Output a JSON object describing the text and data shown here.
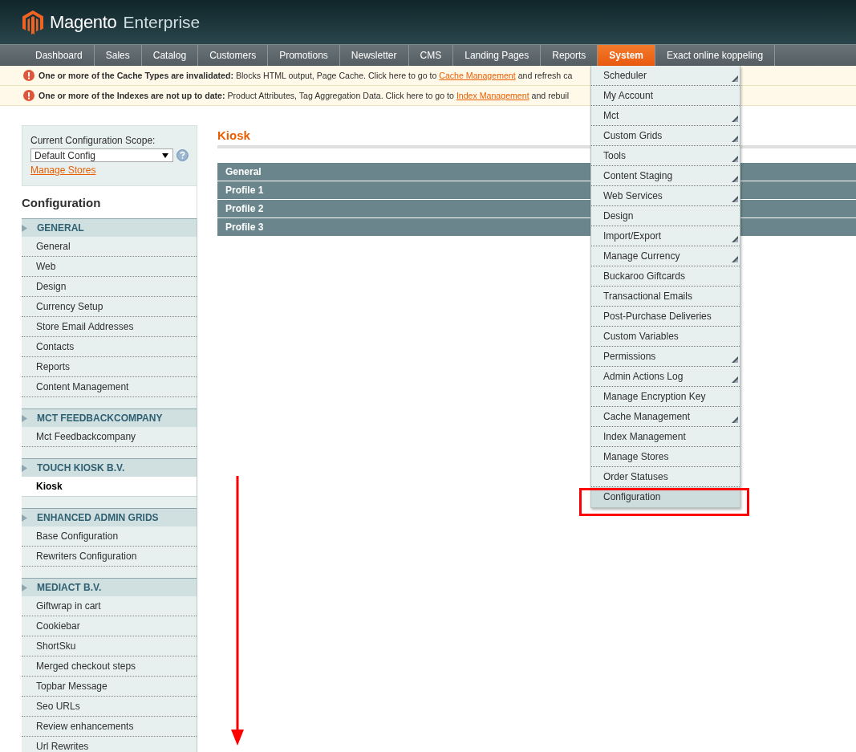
{
  "header": {
    "logo_brand": "Magento",
    "logo_edition": "Enterprise"
  },
  "nav": [
    {
      "label": "Dashboard",
      "selected": false
    },
    {
      "label": "Sales",
      "selected": false
    },
    {
      "label": "Catalog",
      "selected": false
    },
    {
      "label": "Customers",
      "selected": false
    },
    {
      "label": "Promotions",
      "selected": false
    },
    {
      "label": "Newsletter",
      "selected": false
    },
    {
      "label": "CMS",
      "selected": false
    },
    {
      "label": "Landing Pages",
      "selected": false
    },
    {
      "label": "Reports",
      "selected": false
    },
    {
      "label": "System",
      "selected": true
    },
    {
      "label": "Exact online koppeling",
      "selected": false
    }
  ],
  "messages": [
    {
      "bold": "One or more of the Cache Types are invalidated:",
      "text": " Blocks HTML output, Page Cache. Click here to go to ",
      "link": "Cache Management",
      "after": " and refresh ca"
    },
    {
      "bold": "One or more of the Indexes are not up to date:",
      "text": " Product Attributes, Tag Aggregation Data. Click here to go to ",
      "link": "Index Management",
      "after": " and rebuil"
    }
  ],
  "scope": {
    "label": "Current Configuration Scope:",
    "value": "Default Config",
    "link": "Manage Stores"
  },
  "sidebar": {
    "title": "Configuration",
    "groups": [
      {
        "title": "GENERAL",
        "items": [
          {
            "label": "General",
            "selected": false
          },
          {
            "label": "Web",
            "selected": false
          },
          {
            "label": "Design",
            "selected": false
          },
          {
            "label": "Currency Setup",
            "selected": false
          },
          {
            "label": "Store Email Addresses",
            "selected": false
          },
          {
            "label": "Contacts",
            "selected": false
          },
          {
            "label": "Reports",
            "selected": false
          },
          {
            "label": "Content Management",
            "selected": false
          }
        ]
      },
      {
        "title": "MCT FEEDBACKCOMPANY",
        "items": [
          {
            "label": "Mct Feedbackcompany",
            "selected": false
          }
        ]
      },
      {
        "title": "TOUCH KIOSK B.V.",
        "items": [
          {
            "label": "Kiosk",
            "selected": true
          }
        ]
      },
      {
        "title": "ENHANCED ADMIN GRIDS",
        "items": [
          {
            "label": "Base Configuration",
            "selected": false
          },
          {
            "label": "Rewriters Configuration",
            "selected": false
          }
        ]
      },
      {
        "title": "MEDIACT B.V.",
        "items": [
          {
            "label": "Giftwrap in cart",
            "selected": false
          },
          {
            "label": "Cookiebar",
            "selected": false
          },
          {
            "label": "ShortSku",
            "selected": false
          },
          {
            "label": "Merged checkout steps",
            "selected": false
          },
          {
            "label": "Topbar Message",
            "selected": false
          },
          {
            "label": "Seo URLs",
            "selected": false
          },
          {
            "label": "Review enhancements",
            "selected": false
          },
          {
            "label": "Url Rewrites",
            "selected": false
          }
        ]
      }
    ]
  },
  "content": {
    "title": "Kiosk",
    "sections": [
      "General",
      "Profile 1",
      "Profile 2",
      "Profile 3"
    ]
  },
  "system_menu": [
    {
      "label": "Scheduler",
      "submenu": true,
      "selected": false
    },
    {
      "label": "My Account",
      "submenu": false,
      "selected": false
    },
    {
      "label": "Mct",
      "submenu": true,
      "selected": false
    },
    {
      "label": "Custom Grids",
      "submenu": true,
      "selected": false
    },
    {
      "label": "Tools",
      "submenu": true,
      "selected": false
    },
    {
      "label": "Content Staging",
      "submenu": true,
      "selected": false
    },
    {
      "label": "Web Services",
      "submenu": true,
      "selected": false
    },
    {
      "label": "Design",
      "submenu": false,
      "selected": false
    },
    {
      "label": "Import/Export",
      "submenu": true,
      "selected": false
    },
    {
      "label": "Manage Currency",
      "submenu": true,
      "selected": false
    },
    {
      "label": "Buckaroo Giftcards",
      "submenu": false,
      "selected": false
    },
    {
      "label": "Transactional Emails",
      "submenu": false,
      "selected": false
    },
    {
      "label": "Post-Purchase Deliveries",
      "submenu": false,
      "selected": false
    },
    {
      "label": "Custom Variables",
      "submenu": false,
      "selected": false
    },
    {
      "label": "Permissions",
      "submenu": true,
      "selected": false
    },
    {
      "label": "Admin Actions Log",
      "submenu": true,
      "selected": false
    },
    {
      "label": "Manage Encryption Key",
      "submenu": false,
      "selected": false
    },
    {
      "label": "Cache Management",
      "submenu": true,
      "selected": false
    },
    {
      "label": "Index Management",
      "submenu": false,
      "selected": false
    },
    {
      "label": "Manage Stores",
      "submenu": false,
      "selected": false
    },
    {
      "label": "Order Statuses",
      "submenu": false,
      "selected": false
    },
    {
      "label": "Configuration",
      "submenu": false,
      "selected": true
    }
  ]
}
